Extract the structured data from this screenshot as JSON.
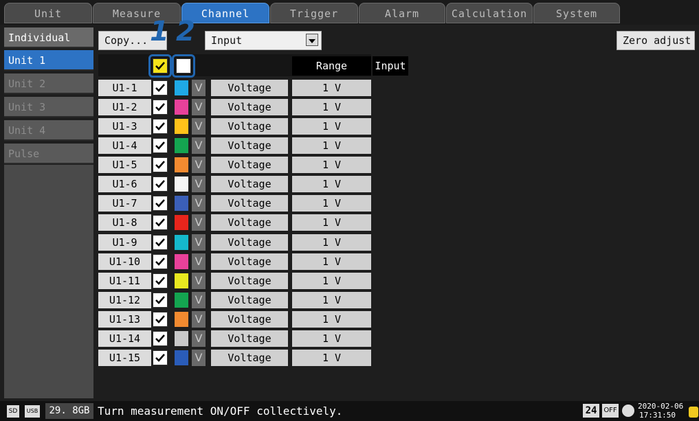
{
  "tabs": [
    {
      "label": "Unit",
      "active": false
    },
    {
      "label": "Measure",
      "active": false
    },
    {
      "label": "Channel",
      "active": true
    },
    {
      "label": "Trigger",
      "active": false
    },
    {
      "label": "Alarm",
      "active": false
    },
    {
      "label": "Calculation",
      "active": false
    },
    {
      "label": "System",
      "active": false
    }
  ],
  "sidebar": {
    "items": [
      {
        "label": "Individual"
      },
      {
        "label": "Unit 1",
        "active": true
      },
      {
        "label": "Unit 2"
      },
      {
        "label": "Unit 3"
      },
      {
        "label": "Unit 4"
      },
      {
        "label": "Pulse"
      }
    ]
  },
  "toolbar": {
    "copy_label": "Copy...",
    "view_select": "Input",
    "zero_adjust_label": "Zero adjust"
  },
  "table": {
    "headers": {
      "range": "Range",
      "input": "Input"
    },
    "rows": [
      {
        "channel": "U1-1",
        "checked": true,
        "color": "#1fa9e6",
        "mode": "Voltage",
        "range": "1 V"
      },
      {
        "channel": "U1-2",
        "checked": true,
        "color": "#e8419a",
        "mode": "Voltage",
        "range": "1 V"
      },
      {
        "channel": "U1-3",
        "checked": true,
        "color": "#ffc21a",
        "mode": "Voltage",
        "range": "1 V"
      },
      {
        "channel": "U1-4",
        "checked": true,
        "color": "#14a550",
        "mode": "Voltage",
        "range": "1 V"
      },
      {
        "channel": "U1-5",
        "checked": true,
        "color": "#f28a30",
        "mode": "Voltage",
        "range": "1 V"
      },
      {
        "channel": "U1-6",
        "checked": true,
        "color": "#f5f5f5",
        "mode": "Voltage",
        "range": "1 V"
      },
      {
        "channel": "U1-7",
        "checked": true,
        "color": "#3b5fb8",
        "mode": "Voltage",
        "range": "1 V"
      },
      {
        "channel": "U1-8",
        "checked": true,
        "color": "#e8251c",
        "mode": "Voltage",
        "range": "1 V"
      },
      {
        "channel": "U1-9",
        "checked": true,
        "color": "#15b8cc",
        "mode": "Voltage",
        "range": "1 V"
      },
      {
        "channel": "U1-10",
        "checked": true,
        "color": "#e8419a",
        "mode": "Voltage",
        "range": "1 V"
      },
      {
        "channel": "U1-11",
        "checked": true,
        "color": "#e8e820",
        "mode": "Voltage",
        "range": "1 V"
      },
      {
        "channel": "U1-12",
        "checked": true,
        "color": "#14a550",
        "mode": "Voltage",
        "range": "1 V"
      },
      {
        "channel": "U1-13",
        "checked": true,
        "color": "#f28a30",
        "mode": "Voltage",
        "range": "1 V"
      },
      {
        "channel": "U1-14",
        "checked": true,
        "color": "#c8c8c8",
        "mode": "Voltage",
        "range": "1 V"
      },
      {
        "channel": "U1-15",
        "checked": true,
        "color": "#2a5cb8",
        "mode": "Voltage",
        "range": "1 V"
      }
    ],
    "unit_symbol": "V"
  },
  "callouts": {
    "one": "1",
    "two": "2"
  },
  "status": {
    "sd_label": "SD",
    "usb_label": "USB",
    "storage": "29. 8GB",
    "message": "Turn measurement ON/OFF collectively.",
    "badge_number": "24",
    "badge_off": "OFF",
    "date": "2020-02-06",
    "time": "17:31:50"
  }
}
